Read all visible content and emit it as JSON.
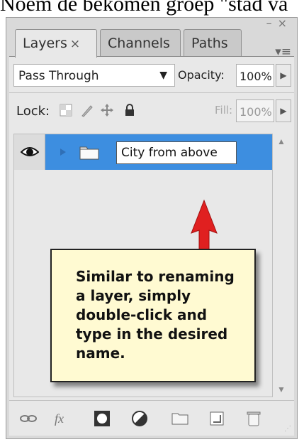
{
  "caption": "Noem de bekomen groep \"stad va",
  "window": {
    "minimize": "–",
    "close": "×"
  },
  "tabs": [
    {
      "label": "Layers",
      "close": "×",
      "active": true
    },
    {
      "label": "Channels",
      "active": false
    },
    {
      "label": "Paths",
      "active": false
    }
  ],
  "panel_menu_icon": "panel-menu-icon",
  "blend": {
    "mode": "Pass Through",
    "opacity_label": "Opacity:",
    "opacity_value": "100%"
  },
  "lock": {
    "label": "Lock:",
    "fill_label": "Fill:",
    "fill_value": "100%"
  },
  "layer": {
    "rename_value": "City from above",
    "visibility_icon": "eye-icon",
    "type_icon": "folder-icon"
  },
  "callout": {
    "text": "Similar to renaming a layer, simply double-click and type in the desired name."
  },
  "colors": {
    "selection": "#3d8ee0",
    "callout_bg": "#fffad2",
    "arrow": "#e02020"
  },
  "bottom_icons": [
    "link-icon",
    "fx-icon",
    "mask-icon",
    "adjustment-icon",
    "new-group-icon",
    "new-layer-icon",
    "trash-icon"
  ]
}
